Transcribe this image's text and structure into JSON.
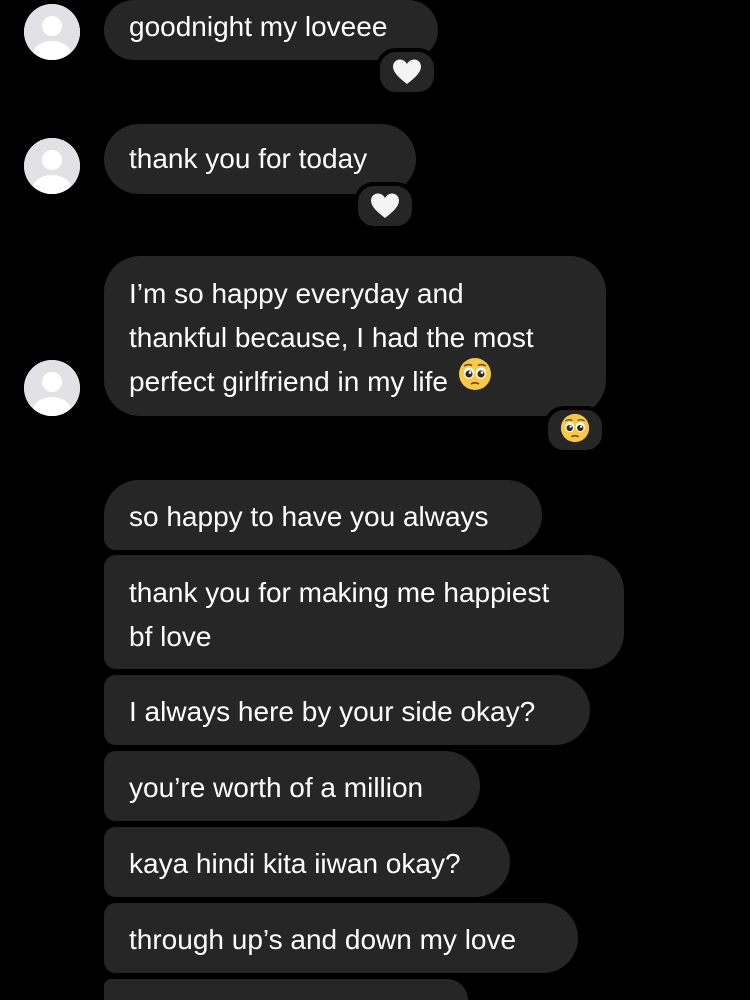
{
  "conversation": {
    "messages": [
      {
        "text": "goodnight my loveee",
        "reaction": "white-heart-icon"
      },
      {
        "text": "thank you for today",
        "reaction": "white-heart-icon"
      },
      {
        "lines": [
          "I’m so happy everyday and",
          "thankful because, I had the most",
          "perfect girlfriend in my life"
        ],
        "inline_emoji": "pleading-face-icon",
        "reaction": "pleading-face-icon"
      },
      {
        "text": "so happy to have you always"
      },
      {
        "lines": [
          "thank you for making me happiest",
          "bf love"
        ]
      },
      {
        "text": "I always here by your side okay?"
      },
      {
        "text": "you’re worth of a million"
      },
      {
        "text": "kaya hindi kita iiwan okay?"
      },
      {
        "text": "through up’s and down my love"
      }
    ]
  },
  "colors": {
    "background": "#000000",
    "bubble": "#262626",
    "text": "#ffffff",
    "avatar": "#e2e2e6"
  }
}
